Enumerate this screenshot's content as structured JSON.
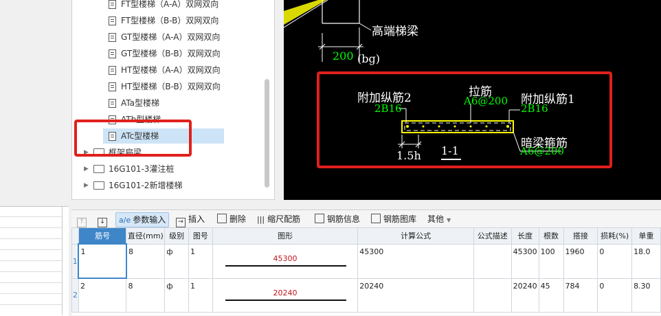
{
  "tree": {
    "items": [
      {
        "label": "FT型楼梯（A-A）双网双向"
      },
      {
        "label": "FT型楼梯（B-B）双网双向"
      },
      {
        "label": "GT型楼梯（A-A）双网双向"
      },
      {
        "label": "GT型楼梯（B-B）双网双向"
      },
      {
        "label": "HT型楼梯（A-A）双网双向"
      },
      {
        "label": "HT型楼梯（B-B）双网双向"
      },
      {
        "label": "ATa型楼梯"
      },
      {
        "label": "ATb型楼梯"
      },
      {
        "label": "ATc型楼梯"
      }
    ],
    "folders": [
      {
        "label": "框架扁梁"
      },
      {
        "label": "16G101-3灌注桩"
      },
      {
        "label": "16G101-2新增楼梯"
      }
    ]
  },
  "cad": {
    "high_beam_label": "高端梯梁",
    "dim_200": "200",
    "dim_bg": "(bg)",
    "extra_long_bar_2": "附加纵筋2",
    "extra_long_bar_2_value": "2B16",
    "tie_bar": "拉筋",
    "tie_bar_value": "A6@200",
    "extra_long_bar_1": "附加纵筋1",
    "extra_long_bar_1_value": "2B16",
    "hidden_beam_stirrup": "暗梁箍筋",
    "hidden_beam_stirrup_value": "A6@200",
    "dim_15h": "1.5h",
    "section_label": "1-1",
    "colors": {
      "background": "#000000",
      "white": "#ffffff",
      "green": "#00ff00",
      "yellow": "#ffff00",
      "highlight": "#e0201b"
    }
  },
  "toolbar": {
    "param_input": "参数输入",
    "insert": "插入",
    "delete": "删除",
    "ruler": "缩尺配筋",
    "rebar_info": "钢筋信息",
    "rebar_library": "钢筋图库",
    "other": "其他"
  },
  "table": {
    "headers": [
      "筋号",
      "直径(mm)",
      "级别",
      "图号",
      "图形",
      "计算公式",
      "公式描述",
      "长度",
      "根数",
      "搭接",
      "损耗(%)",
      "单重"
    ],
    "rows": [
      {
        "num": "1",
        "id": "1",
        "diameter": "8",
        "grade": "ф",
        "fig": "1",
        "shape": "45300",
        "formula": "45300",
        "desc": "",
        "length": "45300",
        "count": "100",
        "lap": "1960",
        "loss": "0",
        "unit_weight": "18.0"
      },
      {
        "num": "2",
        "id": "2",
        "diameter": "8",
        "grade": "ф",
        "fig": "1",
        "shape": "20240",
        "formula": "20240",
        "desc": "",
        "length": "20240",
        "count": "45",
        "lap": "784",
        "loss": "0",
        "unit_weight": "8.30"
      }
    ]
  }
}
